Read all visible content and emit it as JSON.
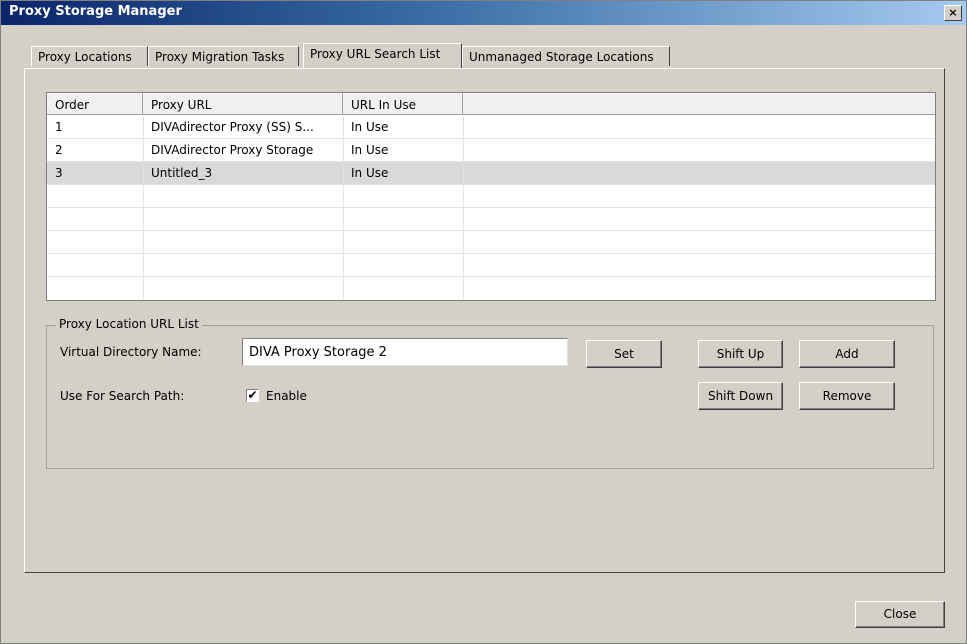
{
  "window": {
    "title": "Proxy Storage Manager",
    "close_glyph": "×"
  },
  "tabs": [
    {
      "label": "Proxy Locations",
      "active": false
    },
    {
      "label": "Proxy Migration Tasks",
      "active": false
    },
    {
      "label": "Proxy URL Search List",
      "active": true
    },
    {
      "label": "Unmanaged Storage Locations",
      "active": false
    }
  ],
  "table": {
    "columns": [
      "Order",
      "Proxy URL",
      "URL In Use",
      ""
    ],
    "rows": [
      {
        "order": "1",
        "proxy_url": "DIVAdirector Proxy (SS) S...",
        "url_in_use": "In Use",
        "selected": false
      },
      {
        "order": "2",
        "proxy_url": "DIVAdirector Proxy Storage",
        "url_in_use": "In Use",
        "selected": false
      },
      {
        "order": "3",
        "proxy_url": "Untitled_3",
        "url_in_use": "In Use",
        "selected": true
      }
    ]
  },
  "group": {
    "legend": "Proxy Location URL List",
    "virtual_dir_label": "Virtual Directory Name:",
    "virtual_dir_value": "DIVA Proxy Storage 2",
    "search_path_label": "Use For Search Path:",
    "enable_label": "Enable",
    "enable_checked": true,
    "check_glyph": "✔"
  },
  "buttons": {
    "set": "Set",
    "shift_up": "Shift Up",
    "add": "Add",
    "shift_down": "Shift Down",
    "remove": "Remove",
    "close": "Close"
  }
}
